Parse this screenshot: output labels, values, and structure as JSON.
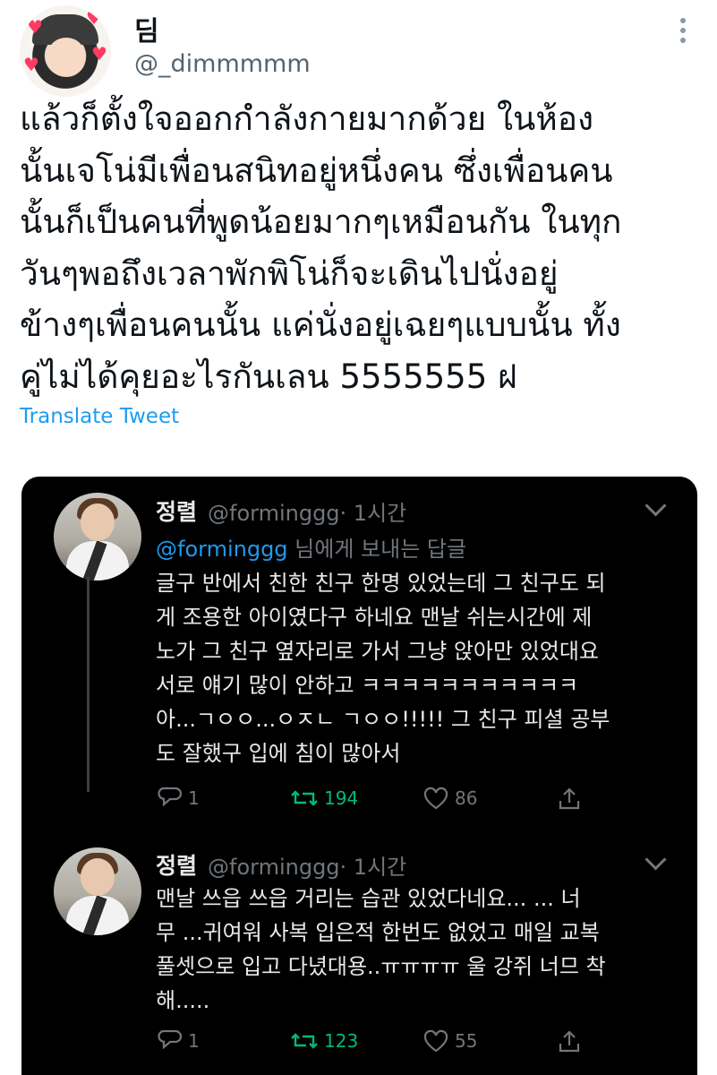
{
  "tweet": {
    "display_name": "딤",
    "handle": "@_dimmmmm",
    "text_lines": [
      "แล้วก็ตั้งใจออกกำลังกายมากด้วย ในห้อง",
      "นั้นเจโน่มีเพื่อนสนิทอยู่หนึ่งคน ซึ่งเพื่อนคน",
      "นั้นก็เป็นคนที่พูดน้อยมากๆเหมือนกัน ในทุก",
      "วันๆพอถึงเวลาพักพิโน่ก็จะเดินไปนั่งอยู่",
      "ข้างๆเพื่อนคนนั้น แค่นั่งอยู่เฉยๆแบบนั้น ทั้ง",
      "คู่ไม่ได้คุยอะไรกันเลน 5555555 ฝ"
    ],
    "translate_label": "Translate Tweet",
    "more_icon": "more-dots-icon"
  },
  "embedded": {
    "replies": [
      {
        "name": "정렬",
        "handle": "@forminggg",
        "time": "· 1시간",
        "replying_mention": "@forminggg",
        "replying_suffix": " 님에게 보내는 답글",
        "text_lines": [
          "글구 반에서 친한 친구 한명 있었는데 그 친구도 되",
          "게 조용한 아이였다구 하네요 맨날 쉬는시간에 제",
          "노가 그 친구 옆자리로 가서 그냥 앉아만 있었대요",
          "서로 얘기 많이 안하고 ㅋㅋㅋㅋㅋㅋㅋㅋㅋㅋㅋ",
          "아...ㄱㅇㅇ...ㅇㅈㄴ ㄱㅇㅇ!!!!! 그 친구 피셜 공부",
          "도 잘했구 입에 침이 많아서"
        ],
        "replies_count": "1",
        "retweets_count": "194",
        "likes_count": "86"
      },
      {
        "name": "정렬",
        "handle": "@forminggg",
        "time": "· 1시간",
        "text_lines": [
          "맨날 쓰읍 쓰읍 거리는 습관 있었다네요... ... 너",
          "무 ...귀여워 사복 입은적 한번도 없었고 매일 교복",
          "풀셋으로 입고 다녔대용..ㅠㅠㅠㅠ 울 강쥐 너므 착",
          "해....."
        ],
        "replies_count": "1",
        "retweets_count": "123",
        "likes_count": "55"
      }
    ],
    "colors": {
      "retweet": "#00ba7c",
      "mention": "#1d9bf0",
      "muted": "#71767b"
    }
  }
}
